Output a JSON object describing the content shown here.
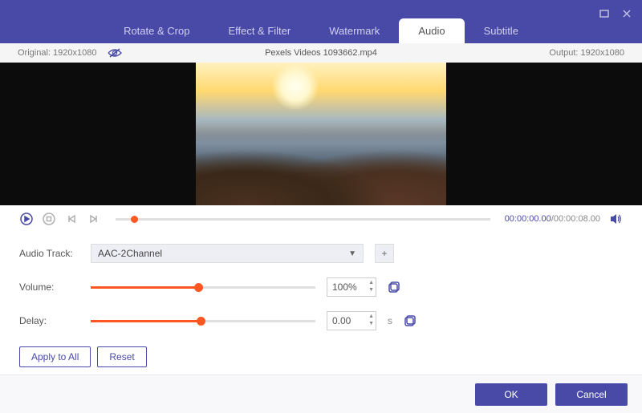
{
  "tabs": {
    "rotate": "Rotate & Crop",
    "effect": "Effect & Filter",
    "watermark": "Watermark",
    "audio": "Audio",
    "subtitle": "Subtitle"
  },
  "info": {
    "original_label": "Original:",
    "original_value": "1920x1080",
    "filename": "Pexels Videos 1093662.mp4",
    "output_label": "Output:",
    "output_value": "1920x1080"
  },
  "time": {
    "current": "00:00:00.00",
    "total": "00:00:08.00"
  },
  "settings": {
    "audio_track_label": "Audio Track:",
    "audio_track_value": "AAC-2Channel",
    "volume_label": "Volume:",
    "volume_value": "100%",
    "delay_label": "Delay:",
    "delay_value": "0.00",
    "delay_unit": "s"
  },
  "buttons": {
    "apply_all": "Apply to All",
    "reset": "Reset",
    "ok": "OK",
    "cancel": "Cancel"
  }
}
